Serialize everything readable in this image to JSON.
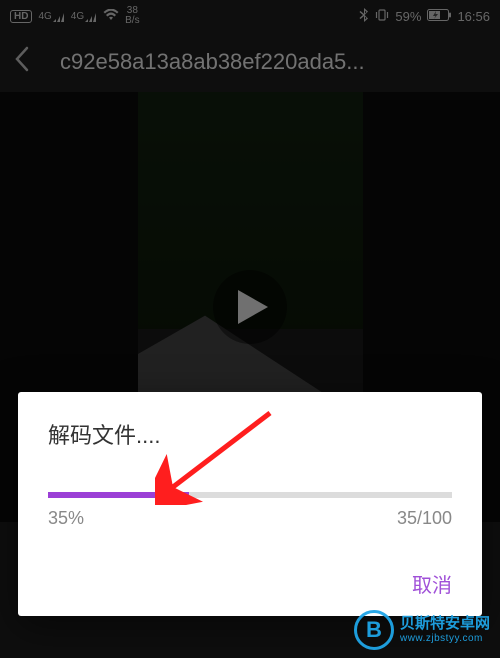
{
  "status_bar": {
    "hd_badge": "HD",
    "sig_4g_1": "4G",
    "sig_4g_2": "4G",
    "net_speed_value": "38",
    "net_speed_unit": "B/s",
    "bluetooth_icon": "bluetooth",
    "vibrate_icon": "vibrate",
    "battery_percent": "59%",
    "battery_icon": "battery",
    "time": "16:56"
  },
  "topbar": {
    "back_icon": "chevron-left",
    "title": "c92e58a13a8ab38ef220ada5..."
  },
  "video": {
    "play_icon": "play"
  },
  "dialog": {
    "title": "解码文件....",
    "progress_percent_text": "35%",
    "progress_fraction_text": "35/100",
    "progress_value": 35,
    "progress_max": 100,
    "cancel_label": "取消"
  },
  "watermark": {
    "logo_letter": "B",
    "name_cn": "贝斯特安卓网",
    "url": "www.zjbstyy.com"
  },
  "colors": {
    "accent_purple": "#9b3fd6",
    "watermark_blue": "#1fa5e8",
    "arrow_red": "#ff1e1e"
  }
}
